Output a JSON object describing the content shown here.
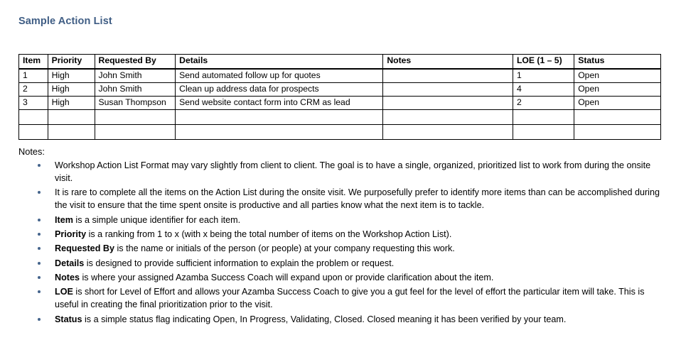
{
  "document": {
    "title": "Sample Action List",
    "title_color": "#3f5d84",
    "bullet_color": "#44648c"
  },
  "table": {
    "columns": [
      "Item",
      "Priority",
      "Requested By",
      "Details",
      "Notes",
      "LOE (1 – 5)",
      "Status"
    ],
    "rows": [
      {
        "item": "1",
        "priority": "High",
        "requested_by": "John Smith",
        "details": "Send automated follow up for quotes",
        "notes": "",
        "loe": "1",
        "status": "Open"
      },
      {
        "item": "2",
        "priority": "High",
        "requested_by": "John Smith",
        "details": "Clean up address data for prospects",
        "notes": "",
        "loe": "4",
        "status": "Open"
      },
      {
        "item": "3",
        "priority": "High",
        "requested_by": "Susan Thompson",
        "details": "Send website contact form into CRM as lead",
        "notes": "",
        "loe": "2",
        "status": "Open"
      },
      {
        "item": "",
        "priority": "",
        "requested_by": "",
        "details": "",
        "notes": "",
        "loe": "",
        "status": ""
      },
      {
        "item": "",
        "priority": "",
        "requested_by": "",
        "details": "",
        "notes": "",
        "loe": "",
        "status": ""
      }
    ]
  },
  "notes": {
    "label": "Notes:",
    "items": [
      {
        "lead": "",
        "text": "Workshop Action List Format may vary slightly from client to client. The goal is to have a single, organized, prioritized list to work from during the onsite visit."
      },
      {
        "lead": "",
        "text": "It is rare to complete all the items on the Action List during the onsite visit. We purposefully prefer to identify more items than can be accomplished during the visit to ensure that the time spent onsite is productive and all parties know what the next item is to tackle."
      },
      {
        "lead": "Item",
        "text": " is a simple unique identifier for each item."
      },
      {
        "lead": "Priority",
        "text": " is a ranking from 1 to x (with x being the total number of items on the Workshop Action List)."
      },
      {
        "lead": "Requested By",
        "text": " is the name or initials of the person (or people) at your company requesting this work."
      },
      {
        "lead": "Details",
        "text": " is designed to provide sufficient information to explain the problem or request."
      },
      {
        "lead": "Notes",
        "text": " is where your assigned Azamba Success Coach will expand upon or provide clarification about the item."
      },
      {
        "lead": "LOE",
        "text": " is short for Level of Effort and allows your Azamba Success Coach to give you a gut feel for the level of effort the particular item will take. This is useful in creating the final prioritization prior to the visit."
      },
      {
        "lead": "Status",
        "text": " is a simple status flag indicating Open, In Progress, Validating, Closed. Closed meaning it has been verified by your team."
      }
    ]
  }
}
